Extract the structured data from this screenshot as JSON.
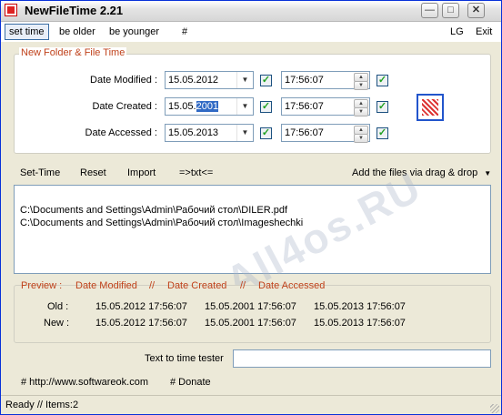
{
  "window": {
    "title": "NewFileTime 2.21"
  },
  "menubar": {
    "items": [
      "set time",
      "be older",
      "be younger",
      "#"
    ],
    "right_items": [
      "LG",
      "Exit"
    ]
  },
  "date_group": {
    "title": "New Folder & File Time",
    "rows": [
      {
        "label": "Date Modified :",
        "date": "15.05.2012",
        "time": "17:56:07",
        "date_checked": true,
        "time_checked": true
      },
      {
        "label": "Date Created :",
        "date_prefix": "15.05.",
        "date_selected": "2001",
        "time": "17:56:07",
        "date_checked": true,
        "time_checked": true
      },
      {
        "label": "Date Accessed :",
        "date": "15.05.2013",
        "time": "17:56:07",
        "date_checked": true,
        "time_checked": true
      }
    ]
  },
  "toolbar": {
    "set_time": "Set-Time",
    "reset": "Reset",
    "import": "Import",
    "txt": "=>txt<=",
    "add_files": "Add the files via drag & drop"
  },
  "files": [
    "C:\\Documents and Settings\\Admin\\Рабочий стол\\DILER.pdf",
    "C:\\Documents and Settings\\Admin\\Рабочий стол\\Imageshechki"
  ],
  "watermark": "All4os.RU",
  "preview": {
    "title": "Preview :",
    "col_modified": "Date Modified",
    "sep": "//",
    "col_created": "Date Created",
    "col_accessed": "Date Accessed",
    "old_label": "Old :",
    "new_label": "New :",
    "old": [
      "15.05.2012 17:56:07",
      "15.05.2001 17:56:07",
      "15.05.2013 17:56:07"
    ],
    "new": [
      "15.05.2012 17:56:07",
      "15.05.2001 17:56:07",
      "15.05.2013 17:56:07"
    ]
  },
  "tester": {
    "label": "Text to time tester",
    "value": ""
  },
  "links": {
    "website": "# http://www.softwareok.com",
    "donate": "# Donate"
  },
  "status": "Ready // Items:2"
}
